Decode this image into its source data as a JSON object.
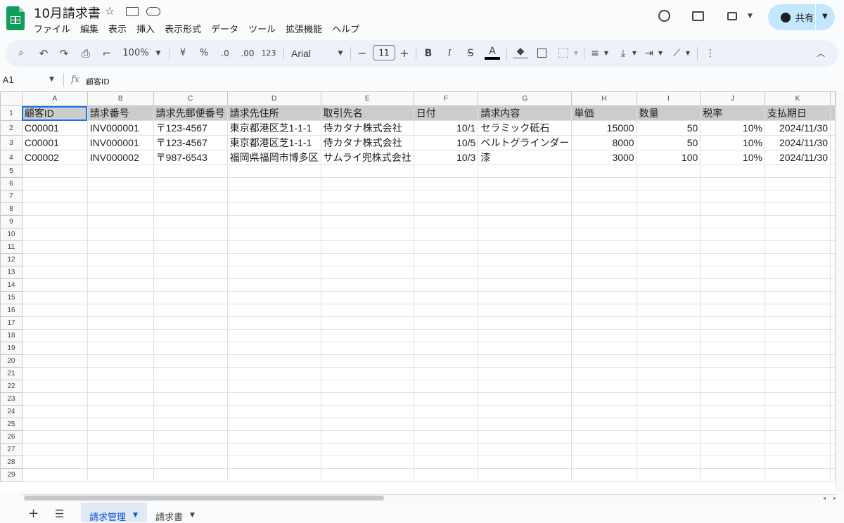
{
  "app": {
    "title": "10月請求書",
    "menu": [
      "ファイル",
      "編集",
      "表示",
      "挿入",
      "表示形式",
      "データ",
      "ツール",
      "拡張機能",
      "ヘルプ"
    ],
    "share_label": "共有",
    "icons": [
      "star-icon",
      "move-to-folder-icon",
      "cloud-saved-icon",
      "history-icon",
      "comment-icon",
      "meet-icon",
      "globe-icon"
    ]
  },
  "toolbar": {
    "zoom": "100%",
    "currency": "¥",
    "percent": "%",
    "dec_decrease": ".0",
    "dec_increase": ".00",
    "more_formats": "123",
    "font": "Arial",
    "font_size": "11",
    "minus": "−",
    "plus": "+",
    "bold": "B",
    "italic": "I",
    "strike": "S",
    "text_color_glyph": "A",
    "text_color": "#000000",
    "accent": "#1a73e8"
  },
  "formula_bar": {
    "cell_ref": "A1",
    "fx": "fx",
    "content": "顧客ID"
  },
  "sheet": {
    "columns": [
      "A",
      "B",
      "C",
      "D",
      "E",
      "F",
      "G",
      "H",
      "I",
      "J",
      "K"
    ],
    "rows": [
      [
        "顧客ID",
        "請求番号",
        "請求先郵便番号",
        "請求先住所",
        "取引先名",
        "日付",
        "請求内容",
        "単価",
        "数量",
        "税率",
        "支払期日"
      ],
      [
        "C00001",
        "INV000001",
        "〒123-4567",
        "東京都港区芝1-1-1",
        "侍カタナ株式会社",
        "10/1",
        "セラミック砥石",
        "15000",
        "50",
        "10%",
        "2024/11/30"
      ],
      [
        "C00001",
        "INV000001",
        "〒123-4567",
        "東京都港区芝1-1-1",
        "侍カタナ株式会社",
        "10/5",
        "ベルトグラインダー",
        "8000",
        "50",
        "10%",
        "2024/11/30"
      ],
      [
        "C00002",
        "INV000002",
        "〒987-6543",
        "福岡県福岡市博多区",
        "サムライ兜株式会社",
        "10/3",
        "漆",
        "3000",
        "100",
        "10%",
        "2024/11/30"
      ]
    ],
    "row_count": 29,
    "header_fill": "#cccccc",
    "selection_color": "#1a73e8"
  },
  "tabs": [
    {
      "label": "請求管理",
      "active": true
    },
    {
      "label": "請求書",
      "active": false
    }
  ]
}
